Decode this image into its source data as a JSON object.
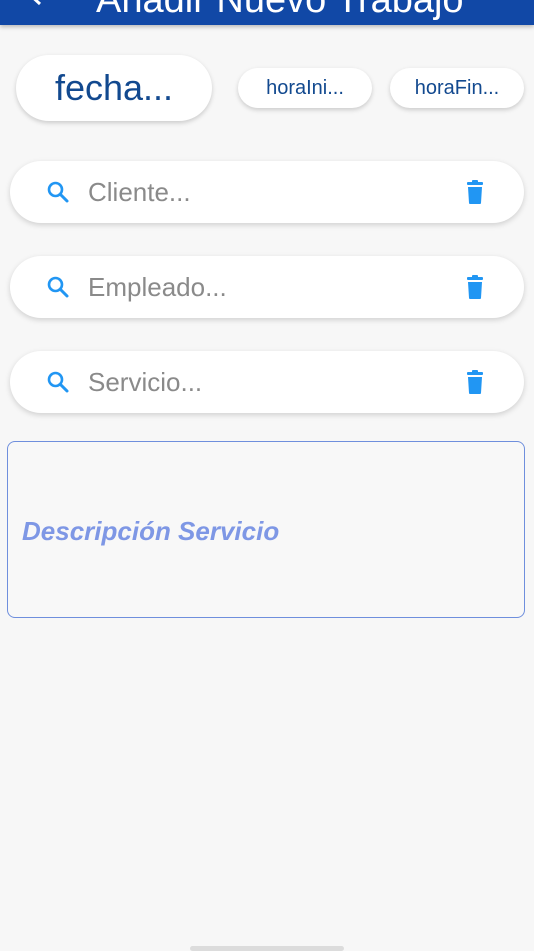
{
  "appbar": {
    "title": "Añadir Nuevo Trabajo",
    "back_icon": "back-arrow-icon",
    "background": "#1148a6"
  },
  "chips": {
    "fecha": "fecha...",
    "hora_inicio": "horaIni...",
    "hora_fin": "horaFin..."
  },
  "searches": {
    "cliente": {
      "placeholder": "Cliente...",
      "value": ""
    },
    "empleado": {
      "placeholder": "Empleado...",
      "value": ""
    },
    "servicio": {
      "placeholder": "Servicio...",
      "value": ""
    }
  },
  "description": {
    "label": "Descripción Servicio"
  },
  "colors": {
    "accent_blue": "#2196f3",
    "chip_text": "#12498f",
    "description_label": "#7e97e5"
  },
  "icons": {
    "search": "search-icon",
    "delete": "trash-icon"
  }
}
